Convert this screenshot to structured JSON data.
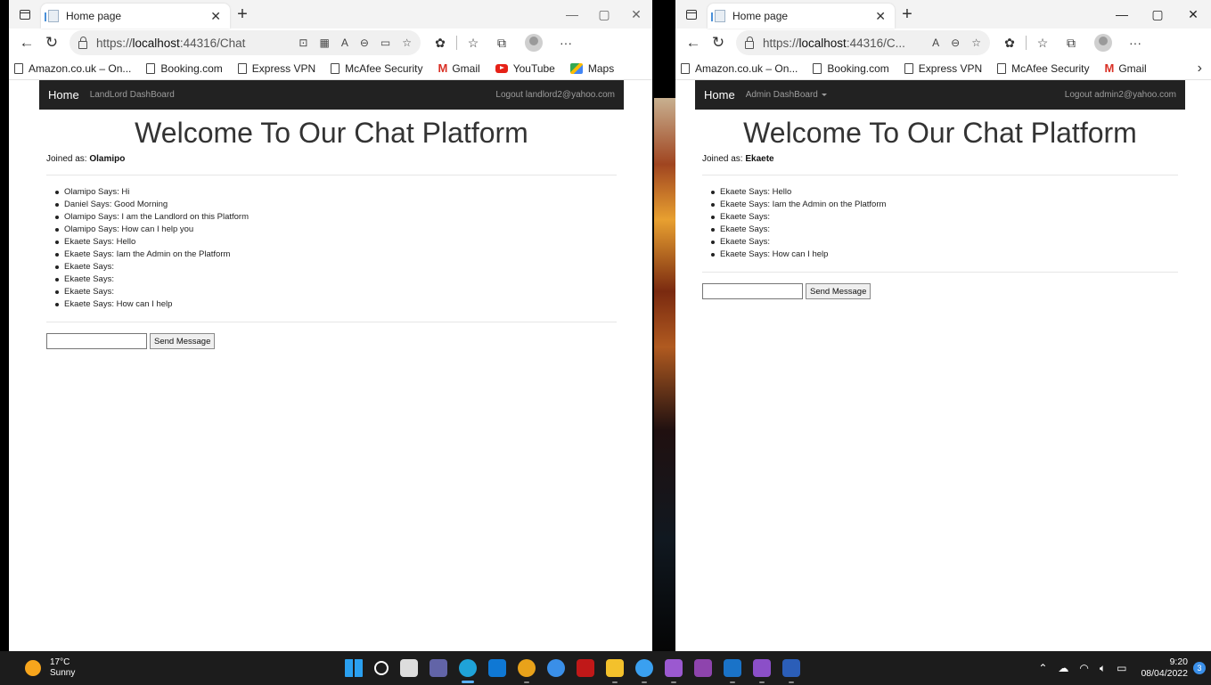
{
  "windows": {
    "left": {
      "tab_title": "Home page",
      "url_prefix": "https://",
      "url_host": "localhost",
      "url_rest": ":44316/Chat",
      "favorites": [
        "Amazon.co.uk – On...",
        "Booking.com",
        "Express VPN",
        "McAfee Security",
        "Gmail",
        "YouTube",
        "Maps"
      ],
      "nav": {
        "brand": "Home",
        "link": "LandLord DashBoard",
        "logout": "Logout landlord2@yahoo.com"
      },
      "heading": "Welcome To Our Chat Platform",
      "joined_label": "Joined as:",
      "joined_name": "Olamipo",
      "messages": [
        "Olamipo Says: Hi",
        "Daniel Says: Good Morning",
        "Olamipo Says: I am the Landlord on this Platform",
        "Olamipo Says: How can I help you",
        "Ekaete Says: Hello",
        "Ekaete Says: Iam the Admin on the Platform",
        "Ekaete Says:",
        "Ekaete Says:",
        "Ekaete Says:",
        "Ekaete Says: How can I help"
      ],
      "message_input_value": "",
      "send_label": "Send Message"
    },
    "right": {
      "tab_title": "Home page",
      "url_prefix": "https://",
      "url_host": "localhost",
      "url_rest": ":44316/C...",
      "favorites": [
        "Amazon.co.uk – On...",
        "Booking.com",
        "Express VPN",
        "McAfee Security",
        "Gmail"
      ],
      "nav": {
        "brand": "Home",
        "link": "Admin DashBoard",
        "logout": "Logout admin2@yahoo.com"
      },
      "heading": "Welcome To Our Chat Platform",
      "joined_label": "Joined as:",
      "joined_name": "Ekaete",
      "messages": [
        "Ekaete Says: Hello",
        "Ekaete Says: Iam the Admin on the Platform",
        "Ekaete Says:",
        "Ekaete Says:",
        "Ekaete Says:",
        "Ekaete Says: How can I help"
      ],
      "message_input_value": "",
      "send_label": "Send Message"
    }
  },
  "taskbar": {
    "temperature": "17°C",
    "condition": "Sunny",
    "time": "9:20",
    "date": "08/04/2022",
    "notification_count": "3",
    "app_icons": [
      {
        "name": "windows-start-icon",
        "color": "#2aa0f0"
      },
      {
        "name": "search-icon",
        "color": "#ffffff"
      },
      {
        "name": "task-view-icon",
        "color": "#dddddd"
      },
      {
        "name": "teams-chat-icon",
        "color": "#6264a7"
      },
      {
        "name": "edge-icon",
        "color": "#1fa3d8"
      },
      {
        "name": "store-icon",
        "color": "#0f78d4"
      },
      {
        "name": "chrome-icon",
        "color": "#e8a21a"
      },
      {
        "name": "help-icon",
        "color": "#3a8fe8"
      },
      {
        "name": "mcafee-icon",
        "color": "#c01818"
      },
      {
        "name": "file-explorer-icon",
        "color": "#f3c12c"
      },
      {
        "name": "cortana-icon",
        "color": "#3aa0f0"
      },
      {
        "name": "visual-studio-icon",
        "color": "#9b59d0"
      },
      {
        "name": "visual-studio-icon-2",
        "color": "#8e44ad"
      },
      {
        "name": "outlook-icon",
        "color": "#1a73c8"
      },
      {
        "name": "visual-studio-icon-3",
        "color": "#8b4fc8"
      },
      {
        "name": "word-icon",
        "color": "#2b5eb8"
      }
    ]
  }
}
